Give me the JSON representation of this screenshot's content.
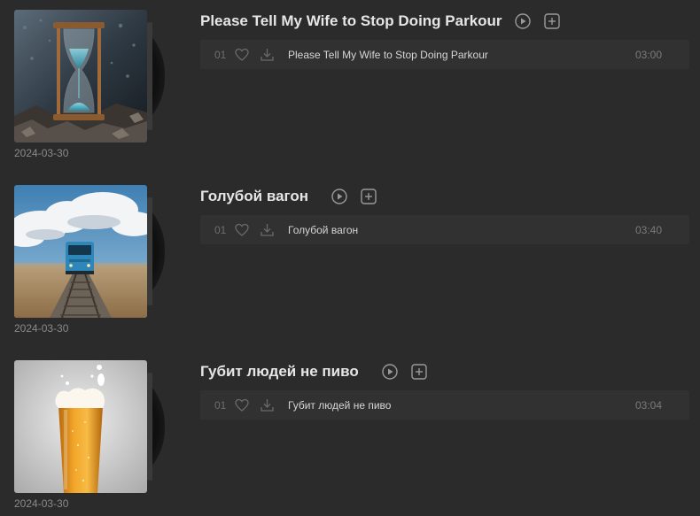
{
  "albums": [
    {
      "title": "Please Tell My Wife to Stop Doing Parkour",
      "date": "2024-03-30",
      "cover_icon": "hourglass-artwork",
      "tracks": [
        {
          "number": "01",
          "name": "Please Tell My Wife to Stop Doing Parkour",
          "duration": "03:00"
        }
      ]
    },
    {
      "title": "Голубой вагон",
      "date": "2024-03-30",
      "cover_icon": "train-on-tracks-artwork",
      "tracks": [
        {
          "number": "01",
          "name": "Голубой вагон",
          "duration": "03:40"
        }
      ]
    },
    {
      "title": "Губит людей не пиво",
      "date": "2024-03-30",
      "cover_icon": "beer-glass-artwork",
      "tracks": [
        {
          "number": "01",
          "name": "Губит людей не пиво",
          "duration": "03:04"
        }
      ]
    }
  ],
  "colors": {
    "background": "#2b2b2b",
    "row_background": "#313131",
    "title_text": "#e6e6e6",
    "muted_text": "#8a8a8a"
  }
}
